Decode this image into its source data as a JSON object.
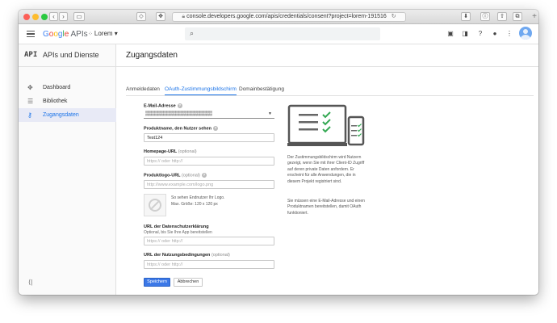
{
  "browser": {
    "url": "console.developers.google.com/apis/credentials/consent?project=lorem-191516",
    "plus": "+"
  },
  "header": {
    "logo_google": [
      "G",
      "o",
      "o",
      "g",
      "l",
      "e"
    ],
    "logo_apis": "APIs",
    "project": "Lorem",
    "project_caret": "▾"
  },
  "sidebar": {
    "api_mark": "API",
    "title": "APIs und Dienste",
    "items": [
      {
        "label": "Dashboard",
        "icon": "dashboard-icon",
        "active": false
      },
      {
        "label": "Bibliothek",
        "icon": "library-icon",
        "active": false
      },
      {
        "label": "Zugangsdaten",
        "icon": "key-icon",
        "active": true
      }
    ],
    "collapse_icon": "collapse-icon"
  },
  "page": {
    "title": "Zugangsdaten",
    "tabs": [
      {
        "label": "Anmeldedaten",
        "active": false
      },
      {
        "label": "OAuth-Zustimmungsbildschirm",
        "active": true
      },
      {
        "label": "Domainbestätigung",
        "active": false
      }
    ]
  },
  "form": {
    "email": {
      "label": "E-Mail-Adresse",
      "value": "▒▒▒▒▒▒▒▒▒▒▒▒▒▒▒▒▒▒▒▒▒▒"
    },
    "product_name": {
      "label": "Produktname, den Nutzer sehen",
      "value": "Test124"
    },
    "homepage": {
      "label": "Homepage-URL",
      "optional": "(optional)",
      "placeholder": "https:// oder http://"
    },
    "logo_url": {
      "label": "Produktlogo-URL",
      "optional": "(optional)",
      "placeholder": "http://www.example.com/logo.png"
    },
    "logo_preview": {
      "line1": "So sehen Endnutzer Ihr Logo.",
      "line2": "Max. Größe: 120 x 120 px"
    },
    "privacy": {
      "label": "URL der Datenschutzerklärung",
      "sub": "Optional, bis Sie Ihre App bereitstellen",
      "placeholder": "https:// oder http://"
    },
    "terms": {
      "label": "URL der Nutzungsbedingungen",
      "optional": "(optional)",
      "placeholder": "https:// oder http://"
    },
    "save_label": "Speichern",
    "cancel_label": "Abbrechen"
  },
  "info": {
    "paragraph1": "Der Zustimmungsbildschirm wird Nutzern gezeigt, wenn Sie mit ihrer Client-ID Zugriff auf deren private Daten anfordern. Er erscheint für alle Anwendungen, die in diesem Projekt registriert sind.",
    "paragraph2": "Sie müssen eine E-Mail-Adresse und einen Produktnamen bereitstellen, damit OAuth funktioniert."
  },
  "colors": {
    "accent": "#1a73e8",
    "primary_button": "#3b78e7",
    "check": "#34a853"
  }
}
